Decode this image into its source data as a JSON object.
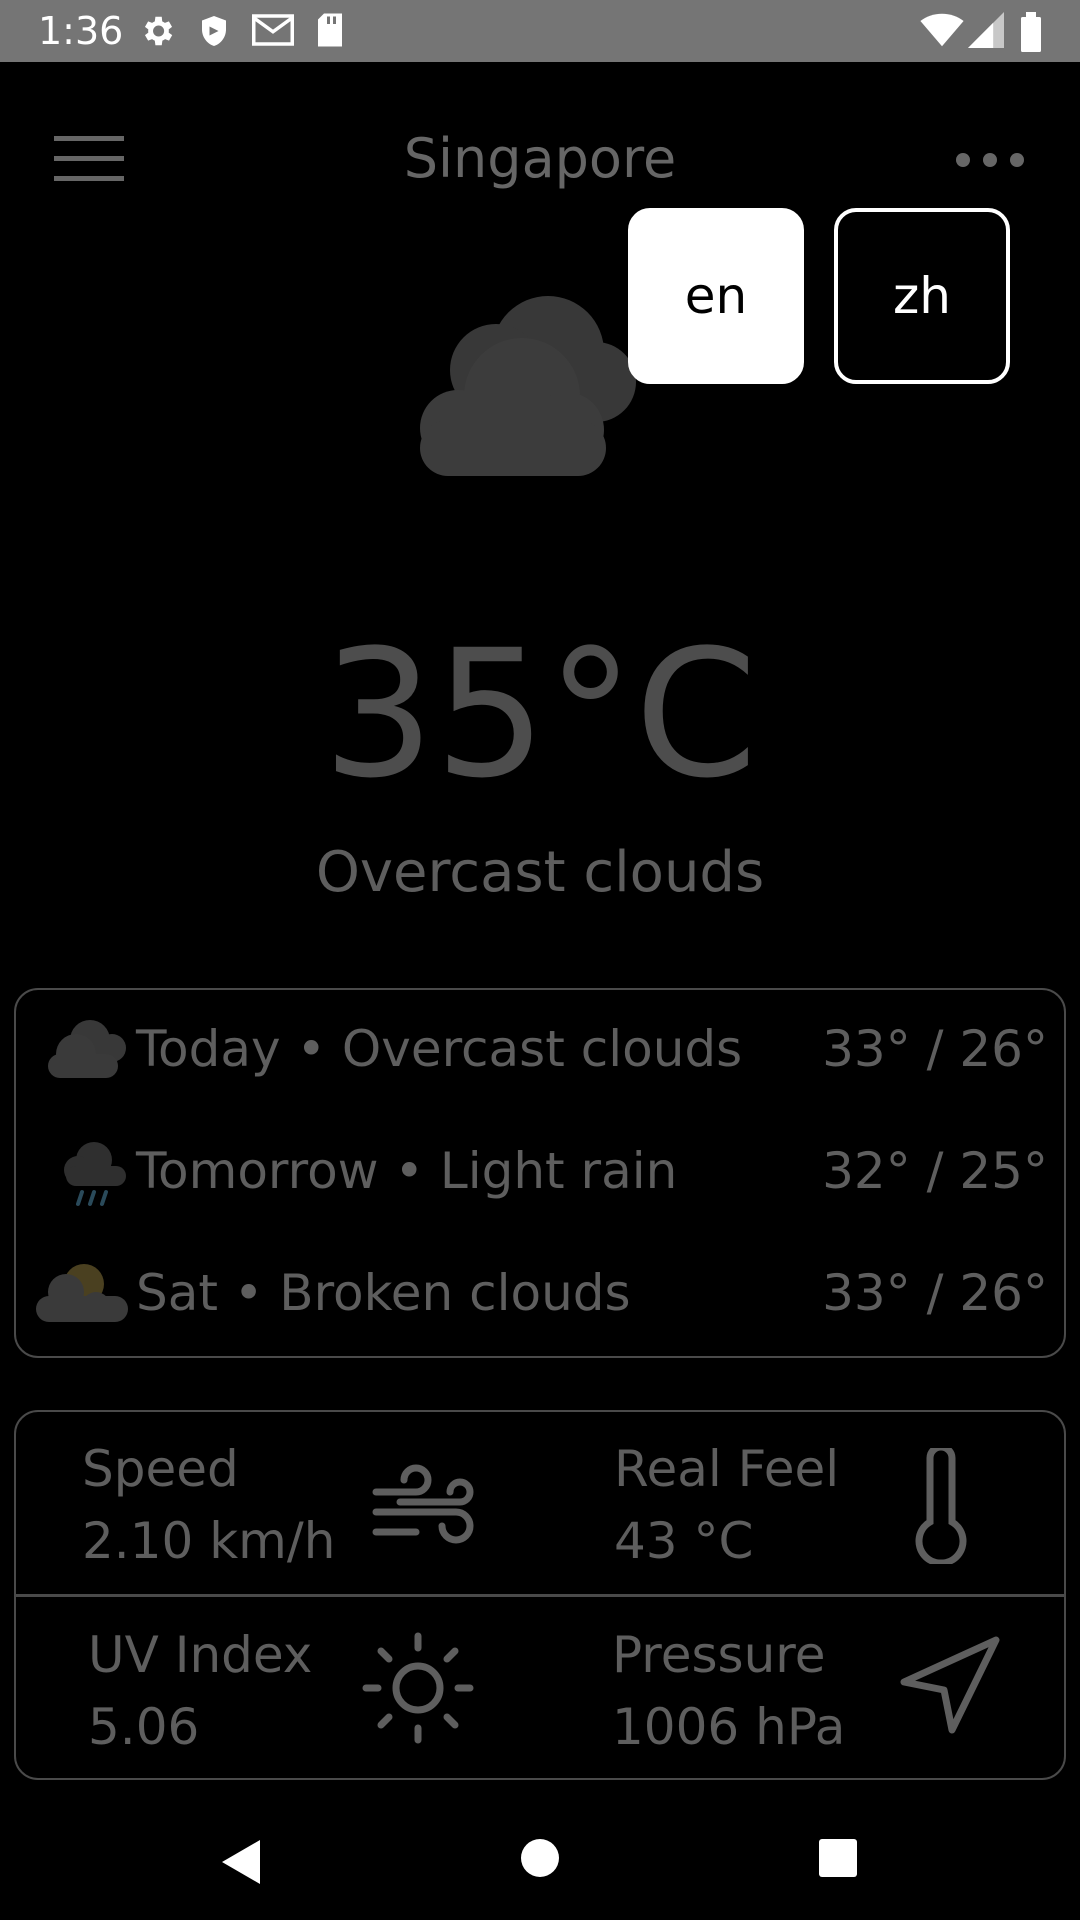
{
  "status_bar": {
    "time": "1:36",
    "icons": [
      "gear-icon",
      "shield-icon",
      "gmail-icon",
      "sd-card-icon",
      "wifi-icon",
      "signal-icon",
      "battery-icon"
    ]
  },
  "header": {
    "city": "Singapore",
    "menu_icon": "hamburger-menu-icon",
    "more_icon": "more-dots-icon"
  },
  "language_buttons": [
    {
      "label": "en",
      "selected": true
    },
    {
      "label": "zh",
      "selected": false
    }
  ],
  "current": {
    "icon": "overcast-clouds-icon",
    "temperature": "35°C",
    "description": "Overcast clouds"
  },
  "forecast": [
    {
      "icon": "overcast-clouds-icon",
      "text": "Today • Overcast clouds",
      "temps": "33° / 26°"
    },
    {
      "icon": "light-rain-icon",
      "text": "Tomorrow • Light rain",
      "temps": "32° / 25°"
    },
    {
      "icon": "broken-clouds-icon",
      "text": "Sat • Broken clouds",
      "temps": "33° / 26°"
    }
  ],
  "details": {
    "speed": {
      "label": "Speed",
      "value": "2.10 km/h",
      "icon": "wind-icon"
    },
    "real_feel": {
      "label": "Real Feel",
      "value": "43 °C",
      "icon": "thermometer-icon"
    },
    "uv_index": {
      "label": "UV Index",
      "value": "5.06",
      "icon": "sun-icon"
    },
    "pressure": {
      "label": "Pressure",
      "value": "1006 hPa",
      "icon": "navigation-arrow-icon"
    }
  },
  "colors": {
    "background": "#000000",
    "status_bar": "#757575",
    "text_dim": "#5e5e5e",
    "card_border": "#4a4a4a",
    "accent_white": "#ffffff"
  }
}
